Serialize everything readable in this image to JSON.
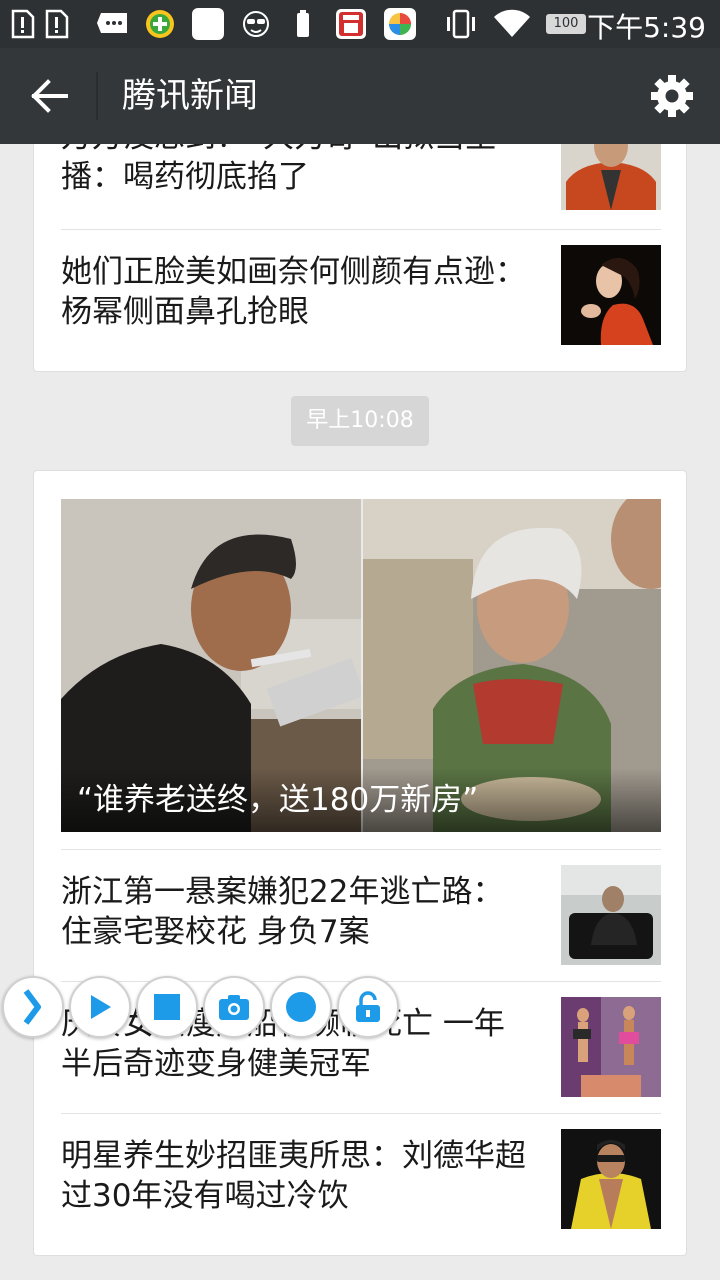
{
  "status_bar": {
    "time": "下午5:39",
    "battery": "100",
    "icons": [
      "sim1-alert-icon",
      "sim2-alert-icon",
      "message-icon",
      "360-plus-icon",
      "blank-app-icon",
      "incognito-icon",
      "battery-small-icon",
      "calendar-app-icon",
      "photo-app-icon",
      "vibrate-icon",
      "wifi-icon",
      "battery-icon"
    ]
  },
  "app_bar": {
    "title": "腾讯新闻",
    "back_icon": "back-arrow-icon",
    "settings_icon": "gear-icon"
  },
  "card1": {
    "items": [
      {
        "title": "万万没想到！“大力哥”出狱当主播：喝药彻底掐了"
      },
      {
        "title": "她们正脸美如画奈何侧颜有点逊：杨幂侧面鼻孔抢眼"
      }
    ]
  },
  "time_separator": "早上10:08",
  "card2": {
    "hero_caption": "“谁养老送终，送180万新房”",
    "items": [
      {
        "title": "浙江第一悬案嫌犯22年逃亡路：住豪宅娶校花 身负7案"
      },
      {
        "title": "厌食女孩瘦成船板濒临死亡 一年半后奇迹变身健美冠军"
      },
      {
        "title": "明星养生妙招匪夷所思：刘德华超过30年没有喝过冷饮"
      }
    ]
  },
  "floating_toolbar": [
    "expand-chevron-icon",
    "play-icon",
    "stop-icon",
    "camera-icon",
    "record-icon",
    "unlock-icon"
  ],
  "colors": {
    "accent": "#1e9be8",
    "app_bar": "#34373a",
    "status_bar": "#2e3133"
  }
}
